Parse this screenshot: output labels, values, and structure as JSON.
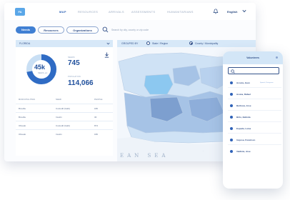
{
  "nav": {
    "logo": "FA",
    "links": [
      "MAP",
      "RESOURCES",
      "ARRIVALS",
      "ASSESSMENTS",
      "HUMANITARIANS"
    ],
    "active": "MAP",
    "language": "English"
  },
  "filters": {
    "pills": [
      "Needs",
      "Resources",
      "Organizations"
    ],
    "active_pill": "Needs",
    "search_placeholder": "Search by city, county or zip code"
  },
  "left": {
    "select_value": "FLORIDA",
    "donut": {
      "value_label": "45k",
      "sub_label": "NEEDS, etc",
      "fraction": 0.72
    },
    "stats": [
      {
        "label": "NEEDS",
        "value": "745"
      },
      {
        "label": "POPULATION",
        "value": "114,066"
      }
    ],
    "table": {
      "headers": [
        "MUNICIPALITIES",
        "NEED",
        "PEOPLE"
      ],
      "rows": [
        [
          "Brevilla",
          "Custodil (Gabi)",
          "180"
        ],
        [
          "Brevilla",
          "Insulin",
          "30"
        ],
        [
          "Olivado",
          "Custodil (Gabi)",
          "874"
        ],
        [
          "Olivado",
          "Insulin",
          "180"
        ]
      ]
    }
  },
  "map": {
    "group_by_label": "GROUPED BY",
    "options": [
      "State / Region",
      "County / Municipality"
    ],
    "selected_option": "County / Municipality",
    "sea_label": "EAN SEA",
    "colors": {
      "light": "#cfe2f5",
      "mid": "#a6c3e6",
      "dark": "#7d9fcf",
      "highlight": "#8cc8f0"
    }
  },
  "phone": {
    "title": "Volunteers",
    "items": [
      {
        "name": "Acosta, Juan",
        "tag": "Spanish, Portuguese"
      },
      {
        "name": "Acuna, Rafael",
        "tag": ""
      },
      {
        "name": "Barbosa, Jose",
        "tag": ""
      },
      {
        "name": "Brito, Belinda",
        "tag": ""
      },
      {
        "name": "Espada, Luisa",
        "tag": ""
      },
      {
        "name": "Inojosa, Francisco",
        "tag": ""
      },
      {
        "name": "Valdivia, Jose",
        "tag": ""
      }
    ]
  }
}
